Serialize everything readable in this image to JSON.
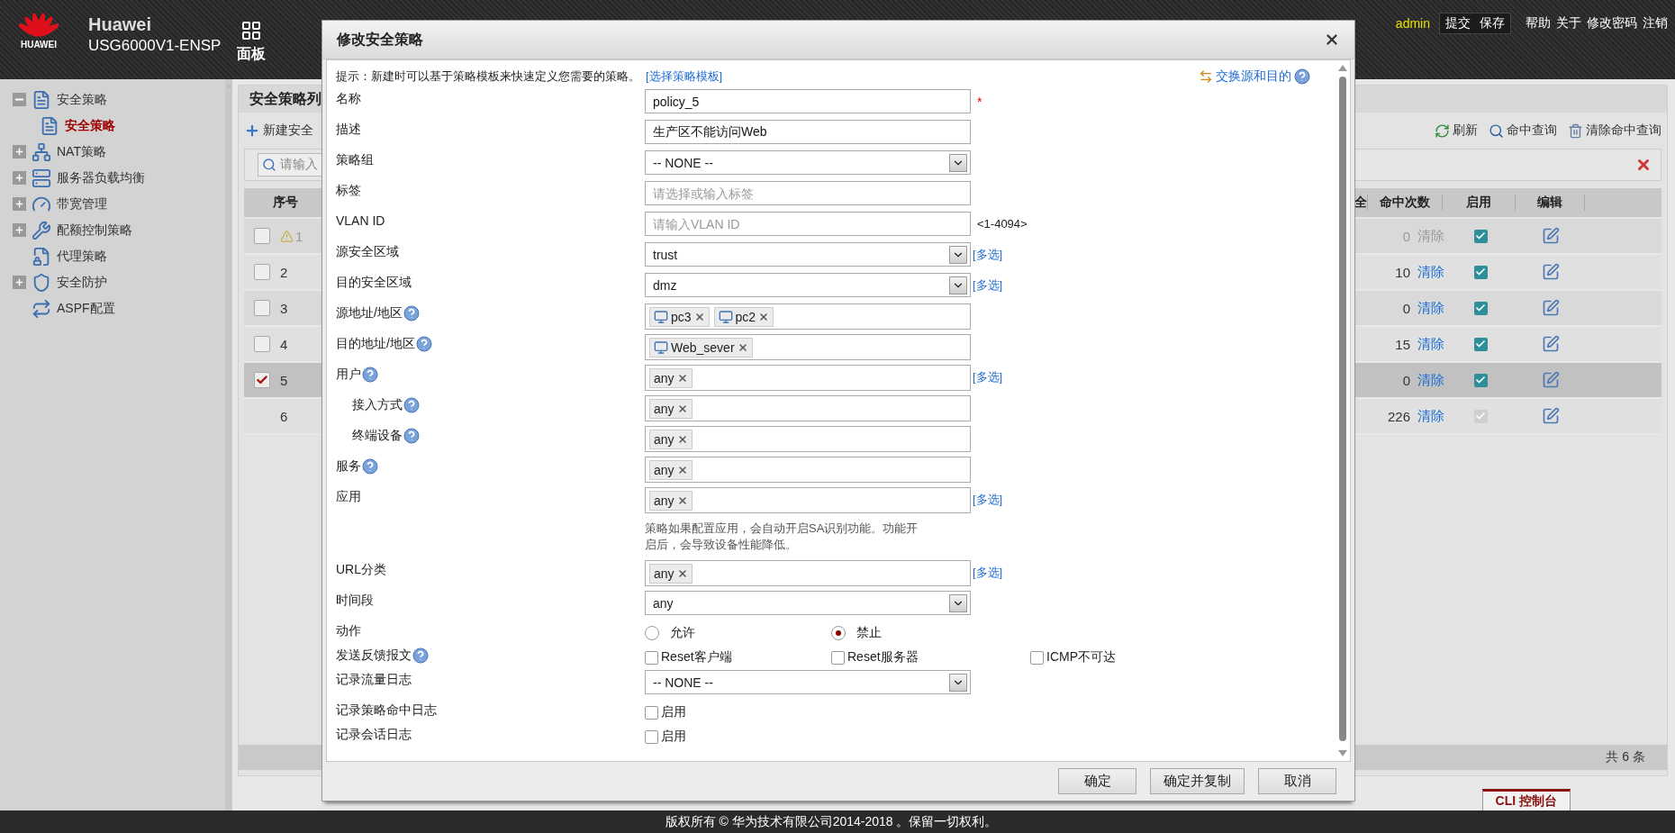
{
  "header": {
    "logo_text": "HUAWEI",
    "brand": "Huawei",
    "model": "USG6000V1-ENSP",
    "nav": [
      {
        "label": "面板"
      }
    ],
    "user": "admin",
    "actions": [
      "提交",
      "保存"
    ],
    "links": [
      "帮助",
      "关于",
      "修改密码",
      "注销"
    ]
  },
  "sidebar": {
    "items": [
      {
        "label": "安全策略",
        "expanded": true,
        "selected": false,
        "children": [
          {
            "label": "安全策略",
            "selected": true
          }
        ]
      },
      {
        "label": "NAT策略",
        "expanded": false,
        "selected": false
      },
      {
        "label": "服务器负载均衡",
        "expanded": false,
        "selected": false
      },
      {
        "label": "带宽管理",
        "expanded": false,
        "selected": false
      },
      {
        "label": "配额控制策略",
        "expanded": false,
        "selected": false
      },
      {
        "label": "代理策略",
        "selected": false
      },
      {
        "label": "安全防护",
        "expanded": false,
        "selected": false
      },
      {
        "label": "ASPF配置",
        "selected": false
      }
    ]
  },
  "panel": {
    "title": "安全策略列",
    "new_button": "新建安全",
    "tools": [
      "刷新",
      "命中查询",
      "清除命中查询"
    ],
    "search_placeholder": "请输入",
    "table": {
      "columns": {
        "number": "序号",
        "column_cut": "全",
        "hits": "命中次数",
        "enabled": "启用",
        "edit": "编辑"
      },
      "rows": [
        {
          "selectable": true,
          "selected": false,
          "warning": true,
          "number": "1",
          "hits": "0",
          "clear": "清除",
          "clear_disabled": true,
          "enabled": true,
          "enabled_locked": false
        },
        {
          "selectable": true,
          "selected": false,
          "warning": false,
          "number": "2",
          "hits": "10",
          "clear": "清除",
          "clear_disabled": false,
          "enabled": true,
          "enabled_locked": false
        },
        {
          "selectable": true,
          "selected": false,
          "warning": false,
          "number": "3",
          "hits": "0",
          "clear": "清除",
          "clear_disabled": false,
          "enabled": true,
          "enabled_locked": false
        },
        {
          "selectable": true,
          "selected": false,
          "warning": false,
          "number": "4",
          "hits": "15",
          "clear": "清除",
          "clear_disabled": false,
          "enabled": true,
          "enabled_locked": false
        },
        {
          "selectable": true,
          "selected": true,
          "warning": false,
          "number": "5",
          "hits": "0",
          "clear": "清除",
          "clear_disabled": false,
          "enabled": true,
          "enabled_locked": false
        },
        {
          "selectable": false,
          "selected": false,
          "warning": false,
          "number": "6",
          "hits": "226",
          "clear": "清除",
          "clear_disabled": false,
          "enabled": true,
          "enabled_locked": true
        }
      ]
    },
    "total": "共 6 条"
  },
  "cli_tab": "CLI 控制台",
  "footer": "版权所有 © 华为技术有限公司2014-2018 。保留一切权利。",
  "dialog": {
    "title": "修改安全策略",
    "hint": "提示：新建时可以基于策略模板来快速定义您需要的策略。",
    "hint_link": "[选择策略模板]",
    "swap_link": "交换源和目的",
    "rows": [
      {
        "kind": "input",
        "label": "名称",
        "value": "policy_5",
        "required_mark": "*"
      },
      {
        "kind": "input",
        "label": "描述",
        "value": "生产区不能访问Web"
      },
      {
        "kind": "select",
        "label": "策略组",
        "value": "-- NONE --"
      },
      {
        "kind": "input",
        "label": "标签",
        "placeholder": "请选择或输入标签"
      },
      {
        "kind": "input",
        "label": "VLAN ID",
        "placeholder": "请输入VLAN ID",
        "suffix": "<1-4094>"
      },
      {
        "kind": "select",
        "label": "源安全区域",
        "value": "trust",
        "link": "[多选]"
      },
      {
        "kind": "select",
        "label": "目的安全区域",
        "value": "dmz",
        "link": "[多选]"
      },
      {
        "kind": "tags",
        "label": "源地址/地区",
        "help": true,
        "tags": [
          {
            "text": "pc3",
            "icon": true
          },
          {
            "text": "pc2",
            "icon": true
          }
        ]
      },
      {
        "kind": "tags",
        "label": "目的地址/地区",
        "help": true,
        "tags": [
          {
            "text": "Web_sever",
            "icon": true
          }
        ]
      },
      {
        "kind": "tags",
        "label": "用户",
        "help": true,
        "tags": [
          {
            "text": "any"
          }
        ],
        "link": "[多选]",
        "children": [
          {
            "kind": "tags",
            "label": "接入方式",
            "help": true,
            "tags": [
              {
                "text": "any"
              }
            ]
          },
          {
            "kind": "tags",
            "label": "终端设备",
            "help": true,
            "tags": [
              {
                "text": "any"
              }
            ]
          }
        ]
      },
      {
        "kind": "tags",
        "label": "服务",
        "help": true,
        "tags": [
          {
            "text": "any"
          }
        ]
      },
      {
        "kind": "tags",
        "label": "应用",
        "tags": [
          {
            "text": "any"
          }
        ],
        "link": "[多选]",
        "note": "策略如果配置应用，会自动开启SA识别功能。功能开启后，会导致设备性能降低。"
      },
      {
        "kind": "tags",
        "label": "URL分类",
        "tags": [
          {
            "text": "any"
          }
        ],
        "link": "[多选]"
      },
      {
        "kind": "select",
        "label": "时间段",
        "value": "any"
      },
      {
        "kind": "radio",
        "label": "动作",
        "options": [
          {
            "label": "允许",
            "selected": false
          },
          {
            "label": "禁止",
            "selected": true
          }
        ]
      },
      {
        "kind": "checks",
        "label": "发送反馈报文",
        "help": true,
        "options": [
          {
            "label": "Reset客户端",
            "checked": false
          },
          {
            "label": "Reset服务器",
            "checked": false
          },
          {
            "label": "ICMP不可达",
            "checked": false
          }
        ]
      },
      {
        "kind": "select",
        "label": "记录流量日志",
        "value": "-- NONE --"
      },
      {
        "kind": "checks",
        "label": "记录策略命中日志",
        "options": [
          {
            "label": "启用",
            "checked": false
          }
        ]
      },
      {
        "kind": "checks",
        "label": "记录会话日志",
        "options": [
          {
            "label": "启用",
            "checked": false
          }
        ]
      }
    ],
    "buttons": [
      "确定",
      "确定并复制",
      "取消"
    ]
  }
}
